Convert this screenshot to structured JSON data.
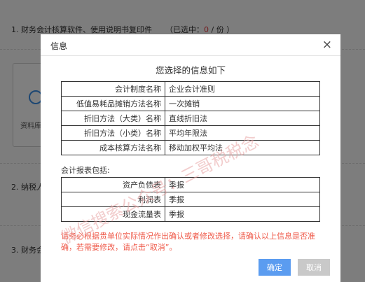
{
  "background": {
    "section1": {
      "title": "1. 财务会计核算软件、使用说明书复印件",
      "selected_prefix": "（已选中：",
      "selected_count": "0",
      "selected_suffix": " / 份 ）"
    },
    "card_label": "资料库",
    "section2_title": "2. 纳税人",
    "section3_title": "3. 财务会"
  },
  "dialog": {
    "title": "信息",
    "close_glyph": "×",
    "heading": "您选择的信息如下",
    "settings": [
      {
        "key": "会计制度名称",
        "value": "企业会计准则"
      },
      {
        "key": "低值易耗品摊销方法名称",
        "value": "一次摊销"
      },
      {
        "key": "折旧方法（大类）名称",
        "value": "直线折旧法"
      },
      {
        "key": "折旧方法（小类）名称",
        "value": "平均年限法"
      },
      {
        "key": "成本核算方法名称",
        "value": "移动加权平均法"
      }
    ],
    "reports_label": "会计报表包括:",
    "reports": [
      {
        "key": "资产负债表",
        "value": "季报"
      },
      {
        "key": "利润表",
        "value": "季报"
      },
      {
        "key": "现金流量表",
        "value": "季报"
      }
    ],
    "notice": "请务必根据贵单位实际情况作出确认或者修改选择，请确认以上信息是否准确，若需要修改，请点击“取消”。",
    "watermark": "微信搜索公众号：三哥税税念",
    "buttons": {
      "ok": "确定",
      "cancel": "取消"
    }
  },
  "colors": {
    "primary_button": "#5b9cf0",
    "disabled_button": "#c9c9c9",
    "notice_text": "#ef5a4a",
    "count_highlight": "#e6393c",
    "watermark": "#e8a4a4"
  }
}
